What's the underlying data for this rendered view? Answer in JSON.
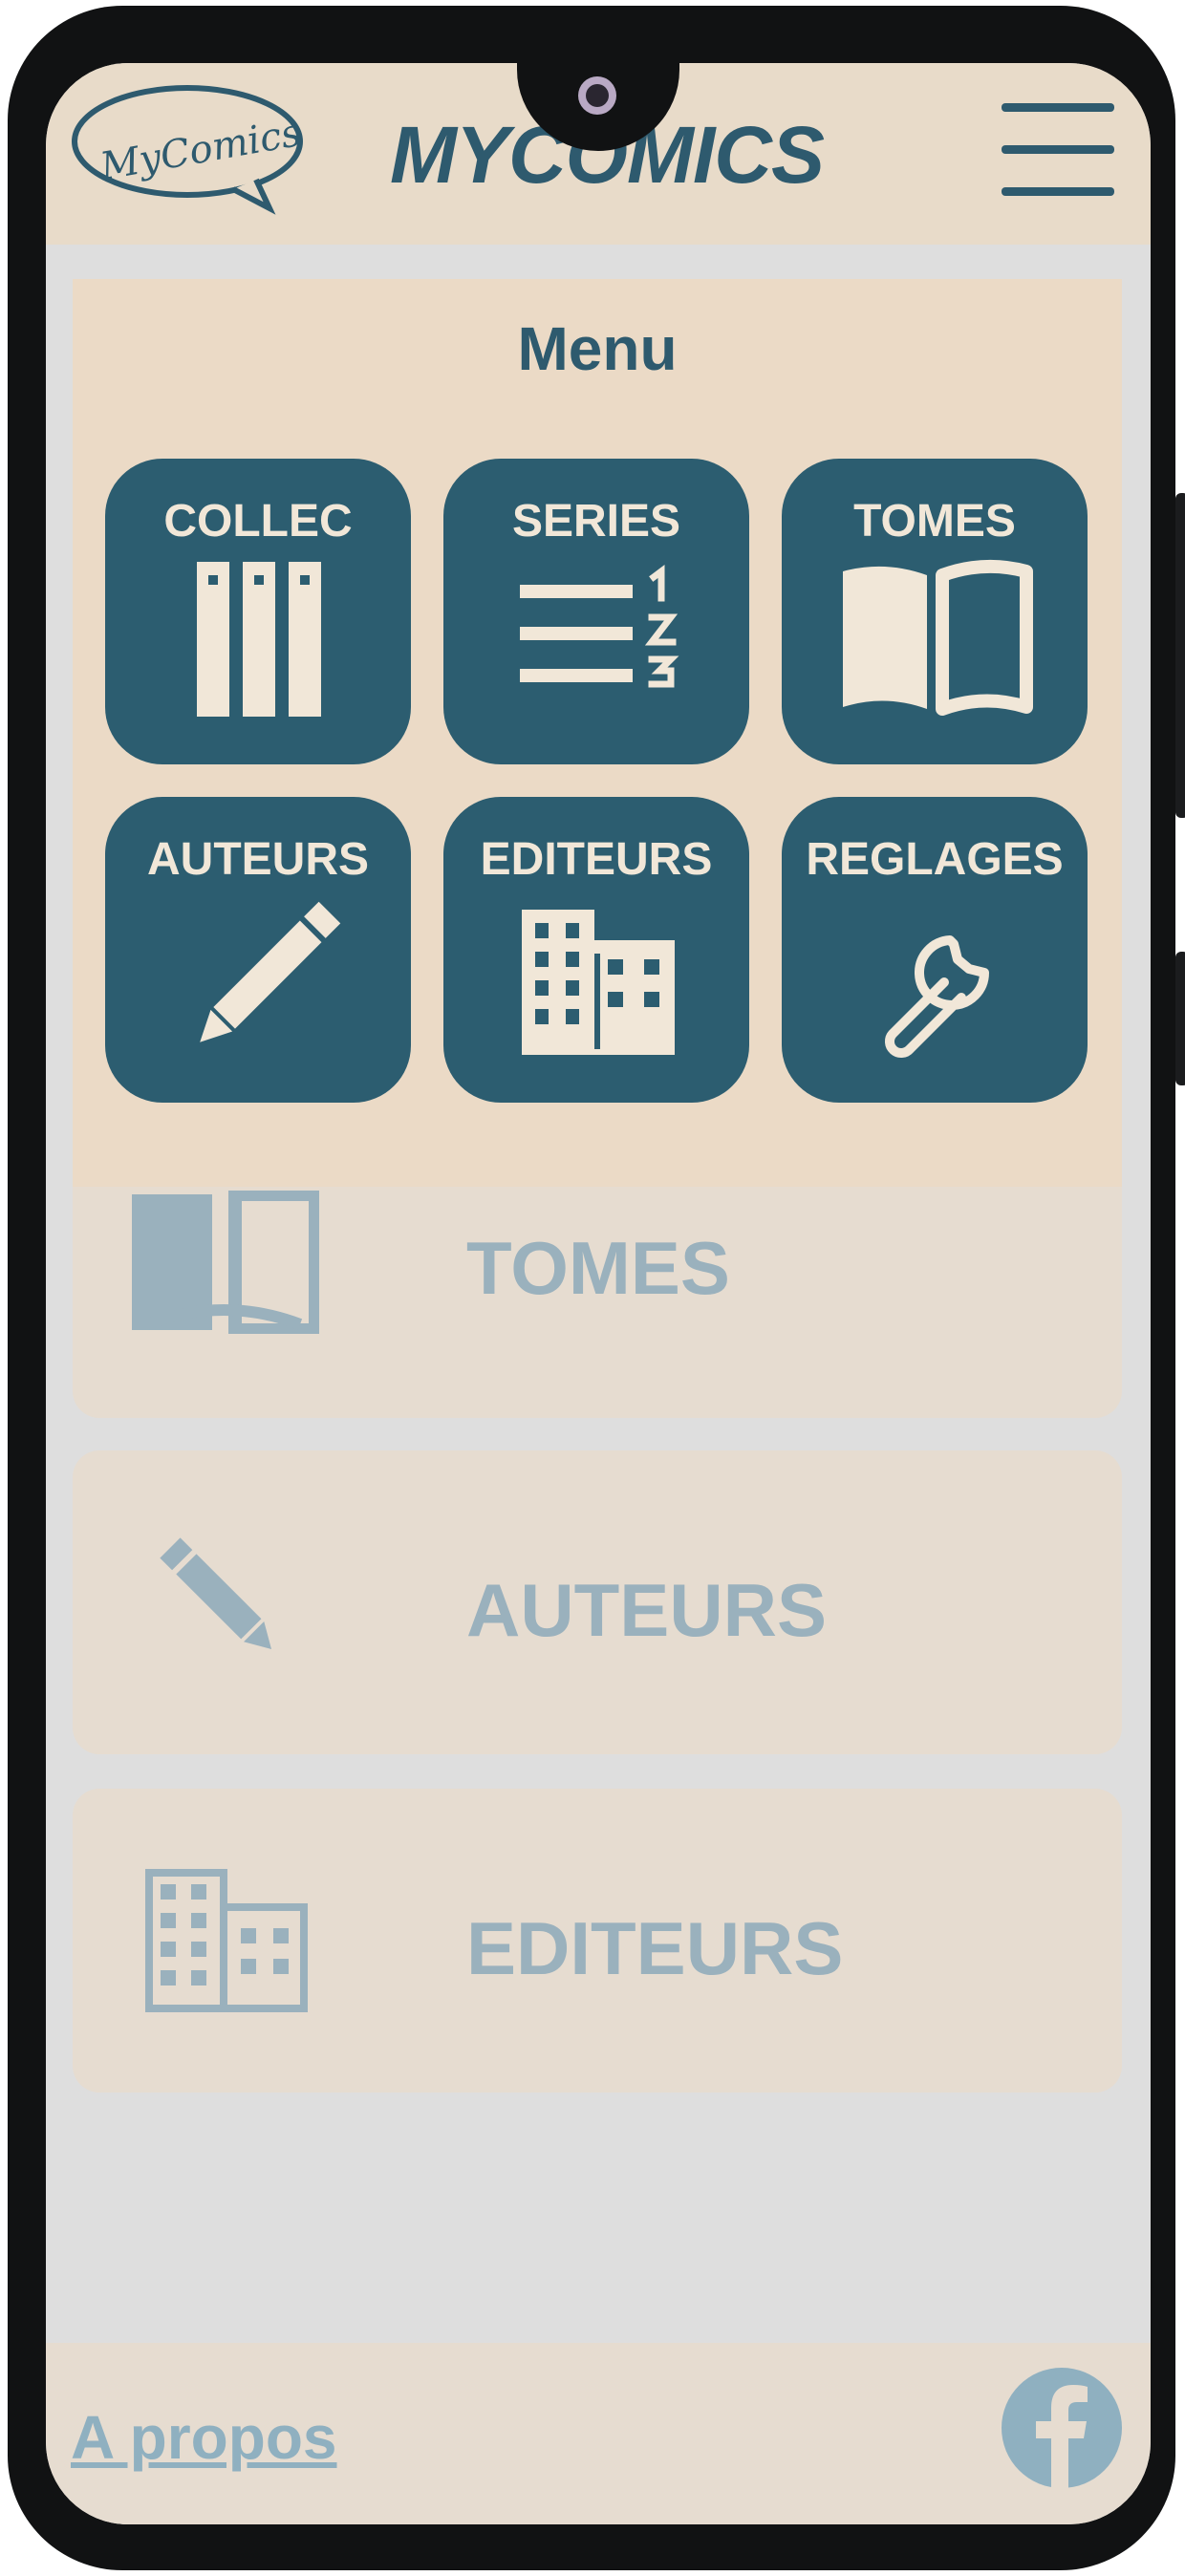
{
  "app": {
    "logo_text": "MyComics",
    "title": "MYCOMICS"
  },
  "menu": {
    "title": "Menu",
    "tiles": [
      {
        "label": "COLLEC",
        "icon": "books-icon"
      },
      {
        "label": "SERIES",
        "icon": "numbered-list-icon"
      },
      {
        "label": "TOMES",
        "icon": "open-book-icon"
      },
      {
        "label": "AUTEURS",
        "icon": "pencil-icon"
      },
      {
        "label": "EDITEURS",
        "icon": "building-icon"
      },
      {
        "label": "REGLAGES",
        "icon": "wrench-icon"
      }
    ]
  },
  "list": {
    "items": [
      {
        "label": "TOMES",
        "icon": "open-book-icon"
      },
      {
        "label": "AUTEURS",
        "icon": "pencil-icon"
      },
      {
        "label": "EDITEURS",
        "icon": "building-icon"
      }
    ]
  },
  "footer": {
    "about_link": "A propos",
    "social_icon": "facebook-icon"
  },
  "colors": {
    "primary": "#2c5d70",
    "beige": "#ebdac6",
    "tile_text": "#f1e7d8",
    "faded": "#9ab1bd"
  }
}
